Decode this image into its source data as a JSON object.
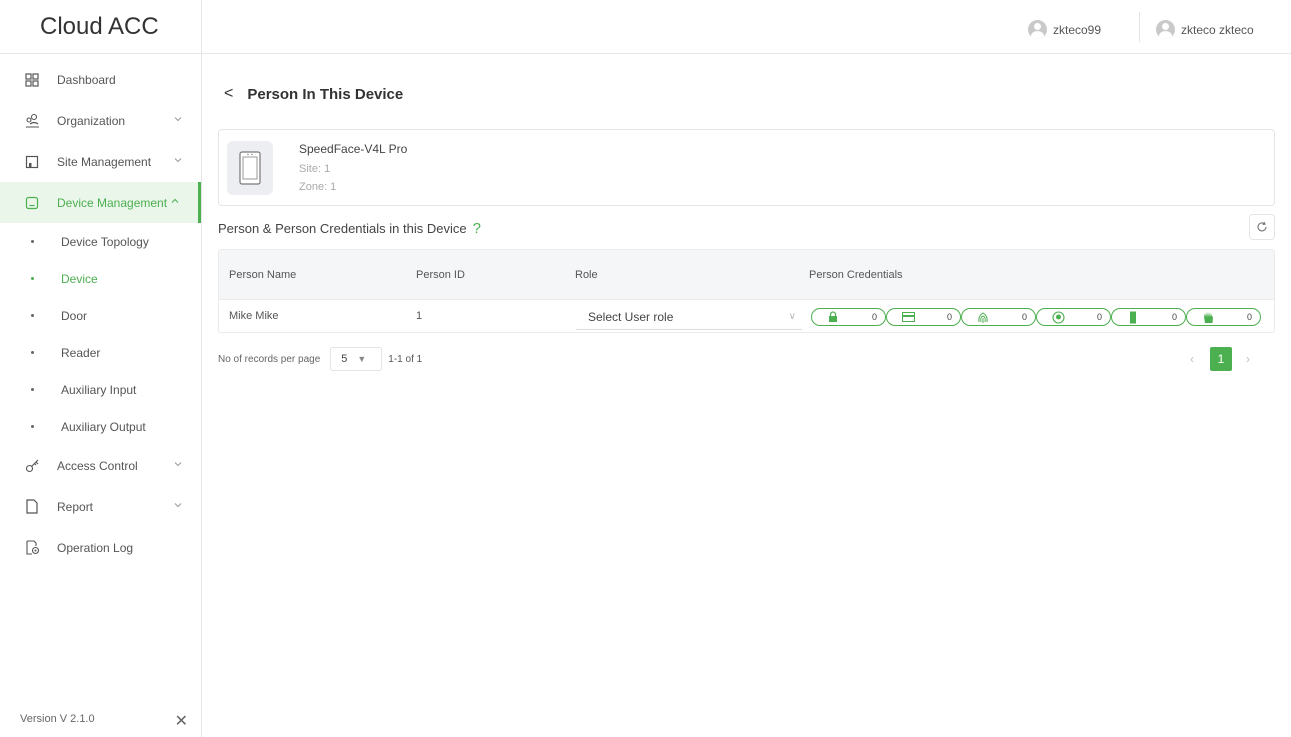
{
  "app": {
    "logo": "Cloud ACC",
    "version": "Version V 2.1.0"
  },
  "sidebar": {
    "items": [
      {
        "label": "Dashboard",
        "icon": "dashboard-icon"
      },
      {
        "label": "Organization",
        "icon": "organization-icon"
      },
      {
        "label": "Site Management",
        "icon": "site-icon"
      },
      {
        "label": "Device Management",
        "icon": "device-icon"
      },
      {
        "label": "Access Control",
        "icon": "key-icon"
      },
      {
        "label": "Report",
        "icon": "report-icon"
      },
      {
        "label": "Operation Log",
        "icon": "log-icon"
      }
    ],
    "sub_items": [
      {
        "label": "Device Topology"
      },
      {
        "label": "Device"
      },
      {
        "label": "Door"
      },
      {
        "label": "Reader"
      },
      {
        "label": "Auxiliary Input"
      },
      {
        "label": "Auxiliary Output"
      }
    ]
  },
  "header": {
    "user1": "zkteco99",
    "user2": "zkteco zkteco"
  },
  "main": {
    "title": "Person In This Device",
    "device": {
      "name": "SpeedFace-V4L Pro",
      "site": "Site: 1",
      "zone": "Zone: 1"
    },
    "section_title": "Person & Person Credentials in this Device",
    "help": "?",
    "table": {
      "headers": [
        "Person Name",
        "Person ID",
        "Role",
        "Person Credentials"
      ],
      "rows": [
        {
          "name": "Mike Mike",
          "id": "1",
          "role_placeholder": "Select User role",
          "credentials": [
            "0",
            "0",
            "0",
            "0",
            "0",
            "0"
          ]
        }
      ]
    },
    "pager": {
      "label": "No of records per page",
      "per_page": "5",
      "range": "1-1 of 1",
      "current": "1"
    }
  },
  "colors": {
    "accent": "#4caf50"
  }
}
